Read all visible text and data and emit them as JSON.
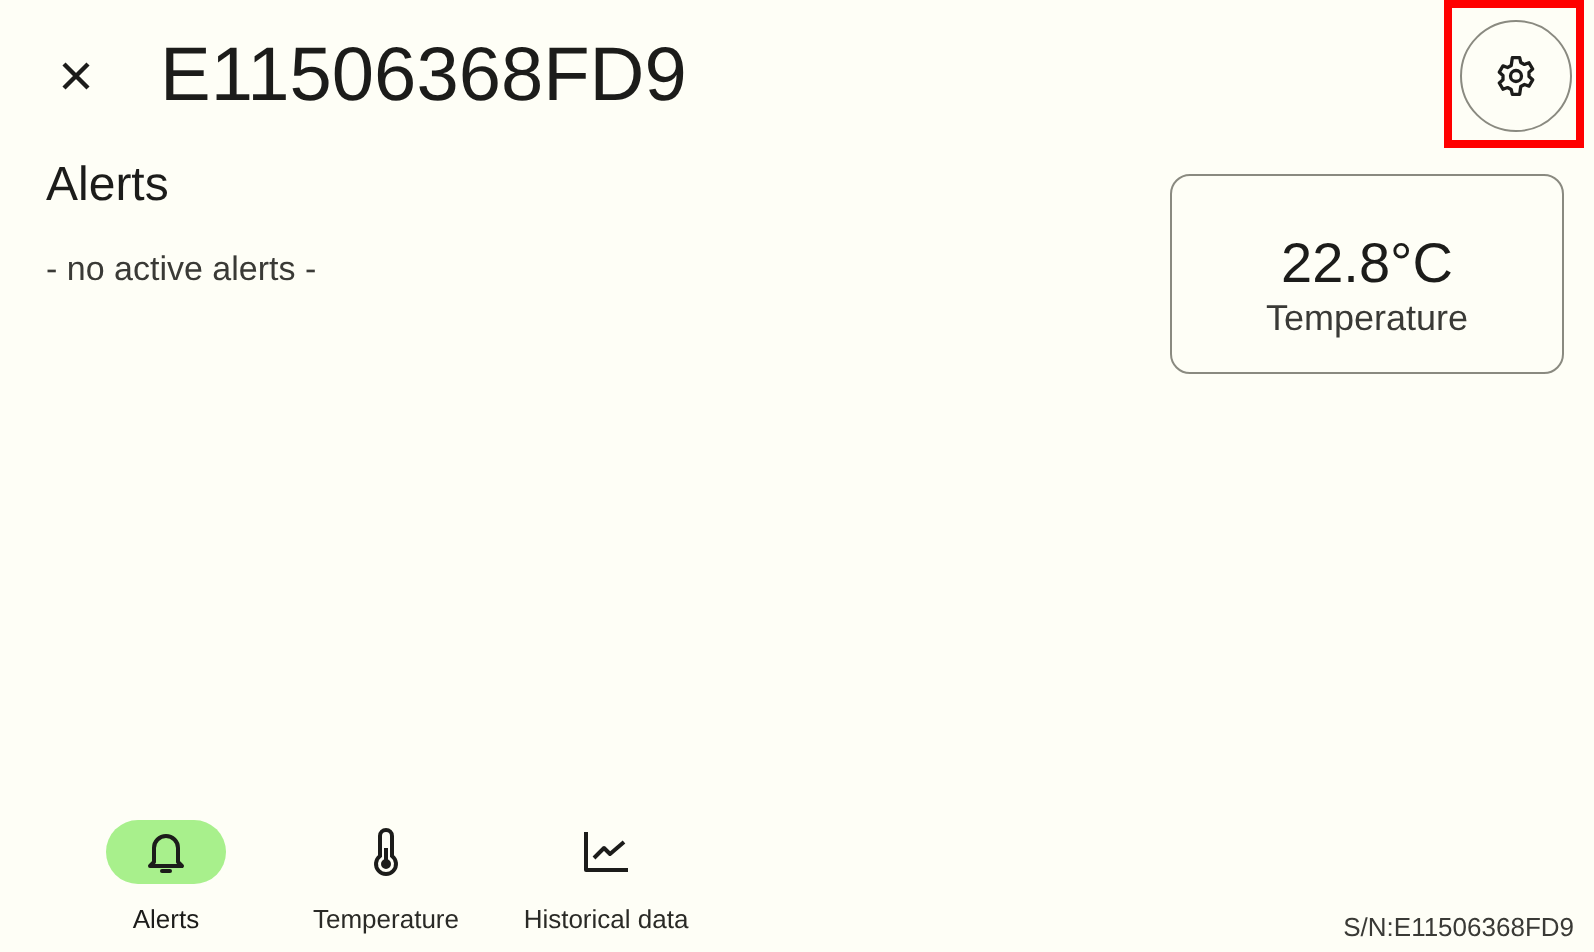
{
  "header": {
    "title": "E11506368FD9",
    "settings_highlighted": true
  },
  "alerts": {
    "heading": "Alerts",
    "empty_text": "- no active alerts -"
  },
  "reading": {
    "value": "22.8°C",
    "label": "Temperature"
  },
  "nav": [
    {
      "kind": "bell",
      "label": "Alerts",
      "selected": true
    },
    {
      "kind": "thermometer",
      "label": "Temperature",
      "selected": false
    },
    {
      "kind": "chart",
      "label": "Historical data",
      "selected": false
    }
  ],
  "serial": "S/N:E11506368FD9"
}
